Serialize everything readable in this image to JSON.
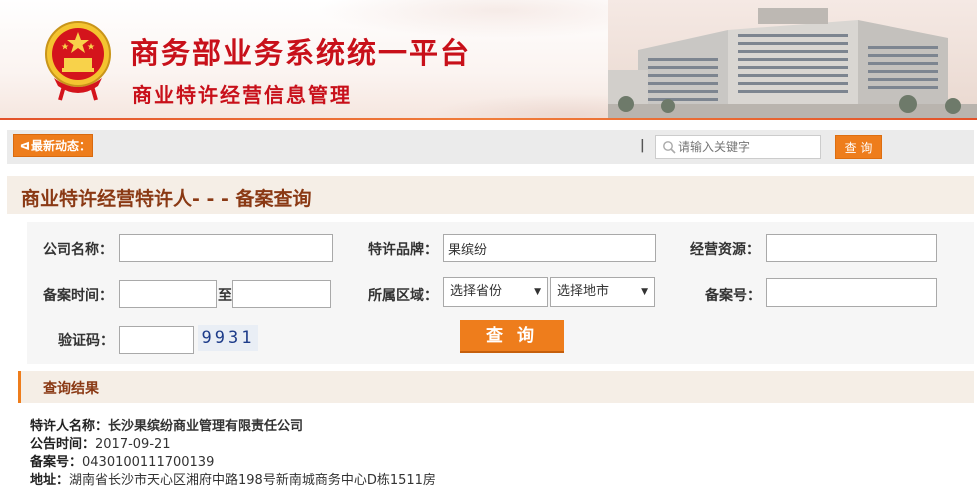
{
  "header": {
    "title": "商务部业务系统统一平台",
    "subtitle": "商业特许经营信息管理"
  },
  "newsbar": {
    "tag_label": "最新动态：",
    "separator": "|",
    "search_placeholder": "请输入关键字",
    "search_button": "查 询"
  },
  "page_title": "商业特许经营特许人- - - 备案查询",
  "form": {
    "company_label": "公司名称：",
    "company_value": "",
    "brand_label": "特许品牌：",
    "brand_value": "果缤纷",
    "resource_label": "经营资源：",
    "resource_value": "",
    "date_label": "备案时间：",
    "date_from": "",
    "date_to_sep": "至",
    "date_to": "",
    "region_label": "所属区域：",
    "province_select": "选择省份",
    "city_select": "选择地市",
    "record_no_label": "备案号：",
    "record_no_value": "",
    "captcha_label": "验证码：",
    "captcha_value": "",
    "captcha_image_text": "9931",
    "submit_label": "查 询"
  },
  "results": {
    "heading": "查询结果",
    "items": [
      {
        "name_key": "特许人名称：",
        "name_val": "长沙果缤纷商业管理有限责任公司",
        "date_key": "公告时间：",
        "date_val": "2017-09-21",
        "record_key": "备案号：",
        "record_val": "0430100111700139",
        "addr_key": "地址：",
        "addr_val": "湖南省长沙市天心区湘府中路198号新南城商务中心D栋1511房"
      }
    ]
  },
  "colors": {
    "brand_red": "#c8101a",
    "accent_orange": "#ee7d1c",
    "section_brown": "#8a3914"
  }
}
